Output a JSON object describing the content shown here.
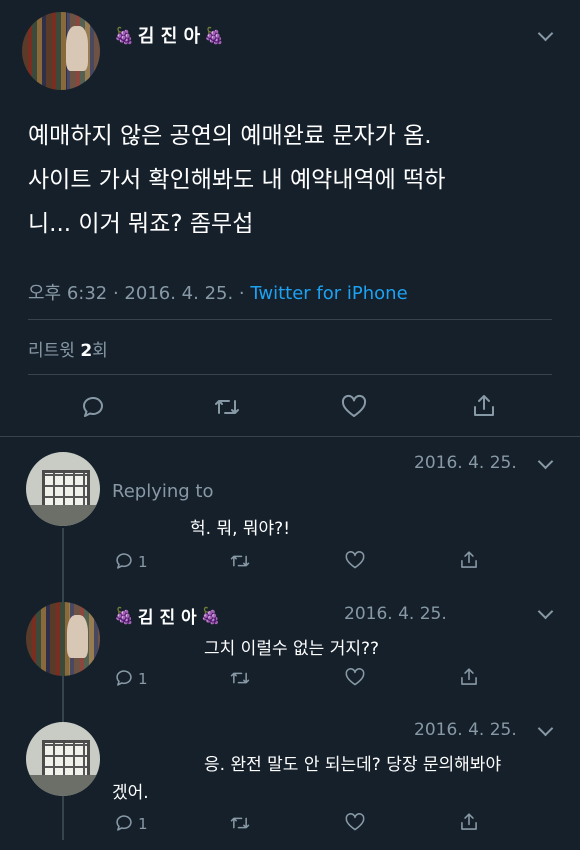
{
  "main_tweet": {
    "author_name": "김 진 아",
    "name_emoji": "🍇",
    "text_lines": [
      "예매하지 않은 공연의 예매완료 문자가 옴.",
      "사이트 가서 확인해봐도 내 예약내역에 떡하",
      "니... 이거 뭐죠? 좀무섭"
    ],
    "time": "오후 6:32 · 2016. 4. 25. · ",
    "source": "Twitter for iPhone",
    "retweet_label": "리트윗",
    "retweet_count": "2",
    "retweet_suffix": "회"
  },
  "replies": [
    {
      "date": "2016. 4. 25.",
      "replying_to": "Replying to",
      "text": "헉. 뭐, 뭐야?!",
      "reply_count": "1"
    },
    {
      "author_name": "김 진 아",
      "date": "2016. 4. 25.",
      "text": "그치 이럴수 없는 거지??",
      "reply_count": "1"
    },
    {
      "date": "2016. 4. 25.",
      "text_line1": "응. 완전 말도 안 되는데? 당장 문의해봐야",
      "text_line2": "겠어.",
      "reply_count": "1"
    }
  ],
  "colors": {
    "background": "#15202b",
    "text": "#ffffff",
    "muted": "#8899a6",
    "link": "#1da1f2",
    "divider": "#38444d"
  },
  "icons": [
    "reply-icon",
    "retweet-icon",
    "like-icon",
    "share-icon",
    "chevron-down-icon",
    "grapes-icon"
  ]
}
